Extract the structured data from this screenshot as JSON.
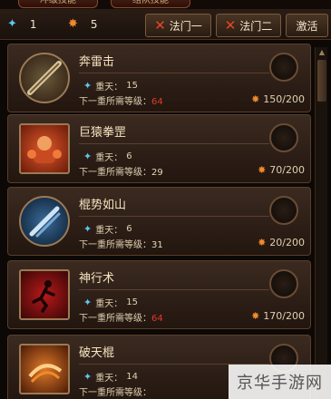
{
  "tabs": [
    "冲级技能",
    "组队技能"
  ],
  "resources": {
    "blue_count": "1",
    "orange_count": "5"
  },
  "buttons": {
    "faction1": "法门一",
    "faction2": "法门二",
    "activate": "激活"
  },
  "level_label": "重天：",
  "next_label": "下一重所需等级：",
  "skills": [
    {
      "name": "奔雷击",
      "level": "15",
      "req_level": "64",
      "cost": "150/200",
      "icon": "staff-icon"
    },
    {
      "name": "巨猿拳罡",
      "level": "6",
      "req_level": "29",
      "cost": "70/200",
      "icon": "ape-fist-icon"
    },
    {
      "name": "棍势如山",
      "level": "6",
      "req_level": "31",
      "cost": "20/200",
      "icon": "mountain-staff-icon"
    },
    {
      "name": "神行术",
      "level": "15",
      "req_level": "64",
      "cost": "170/200",
      "icon": "runner-icon"
    },
    {
      "name": "破天棍",
      "level": "14",
      "req_level": "",
      "cost": "",
      "icon": "sky-staff-icon"
    }
  ],
  "watermark": "京华手游网"
}
